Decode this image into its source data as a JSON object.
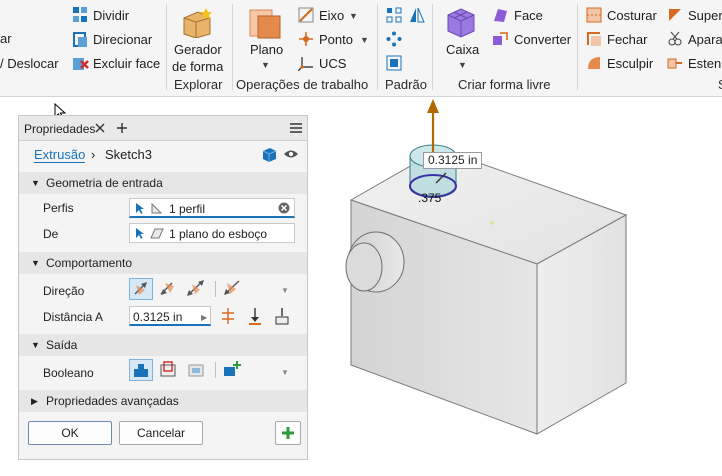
{
  "ribbon": {
    "left_partial": [
      "ar",
      "/ Deslocar"
    ],
    "modify": {
      "split": "Dividir",
      "direct": "Direcionar",
      "delete_face": "Excluir face"
    },
    "explore": {
      "shape_gen_line1": "Gerador",
      "shape_gen_line2": "de forma",
      "group": "Explorar"
    },
    "work": {
      "plane": "Plano",
      "axis": "Eixo",
      "point": "Ponto",
      "ucs": "UCS",
      "group": "Operações de trabalho"
    },
    "pattern": {
      "group": "Padrão"
    },
    "freeform": {
      "box": "Caixa",
      "face": "Face",
      "convert": "Converter",
      "group": "Criar forma livre"
    },
    "surface": {
      "stitch": "Costurar",
      "patch": "Fechar",
      "sculpt": "Esculpir",
      "super": "Super",
      "repair": "Apara",
      "extend": "Esten",
      "group": "Superfície (partial)"
    }
  },
  "panel": {
    "tab_title": "Propriedades",
    "breadcrumb": {
      "feature": "Extrusão",
      "sketch": "Sketch3"
    },
    "sections": {
      "input": {
        "title": "Geometria de entrada",
        "profiles_label": "Perfis",
        "profiles_value": "1 perfil",
        "from_label": "De",
        "from_value": "1 plano do esboço"
      },
      "behavior": {
        "title": "Comportamento",
        "direction_label": "Direção",
        "distance_label": "Distância A",
        "distance_value": "0.3125 in"
      },
      "output": {
        "title": "Saída",
        "boolean_label": "Booleano"
      },
      "advanced": {
        "title": "Propriedades avançadas"
      }
    },
    "ok_label": "OK",
    "cancel_label": "Cancelar"
  },
  "viewport": {
    "distance_tag": "0.3125 in",
    "dim_label": ".375"
  },
  "colors": {
    "accent": "#1a73b9",
    "section_bg": "#e6e6e6",
    "arrow": "#b06a00",
    "add_green": "#2e9b3c"
  }
}
